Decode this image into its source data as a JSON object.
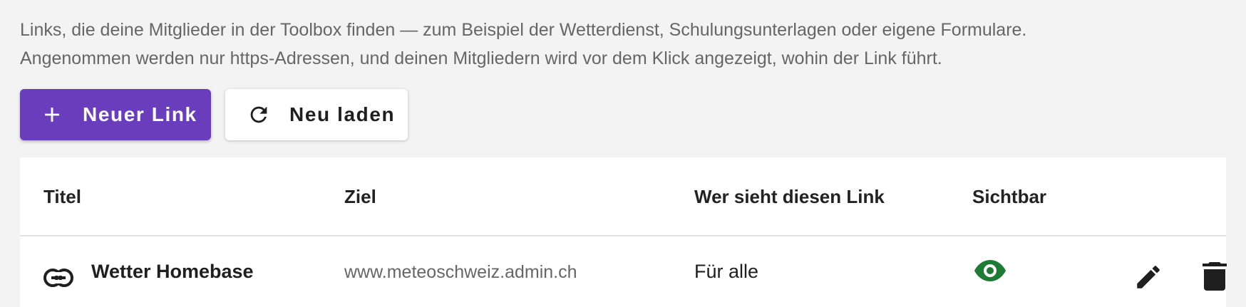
{
  "intro": {
    "line1": "Links, die deine Mitglieder in der Toolbox finden — zum Beispiel der Wetterdienst, Schulungsunterlagen oder eigene Formulare.",
    "line2": "Angenommen werden nur https-Adressen, und deinen Mitgliedern wird vor dem Klick angezeigt, wohin der Link führt."
  },
  "toolbar": {
    "new_link_label": "Neuer Link",
    "reload_label": "Neu laden"
  },
  "table": {
    "columns": [
      "Titel",
      "Ziel",
      "Wer sieht diesen Link",
      "Sichtbar"
    ],
    "rows": [
      {
        "title": "Wetter Homebase",
        "target": "www.meteoschweiz.admin.ch",
        "audience": "Für alle",
        "visible_icon": "eye-icon"
      }
    ]
  },
  "colors": {
    "accent": "#6a3dbd",
    "visible_green": "#1e7b34",
    "background": "#f3f3f3"
  },
  "icons": [
    "plus-icon",
    "refresh-icon",
    "link-icon",
    "eye-icon",
    "pencil-icon",
    "trash-icon"
  ]
}
